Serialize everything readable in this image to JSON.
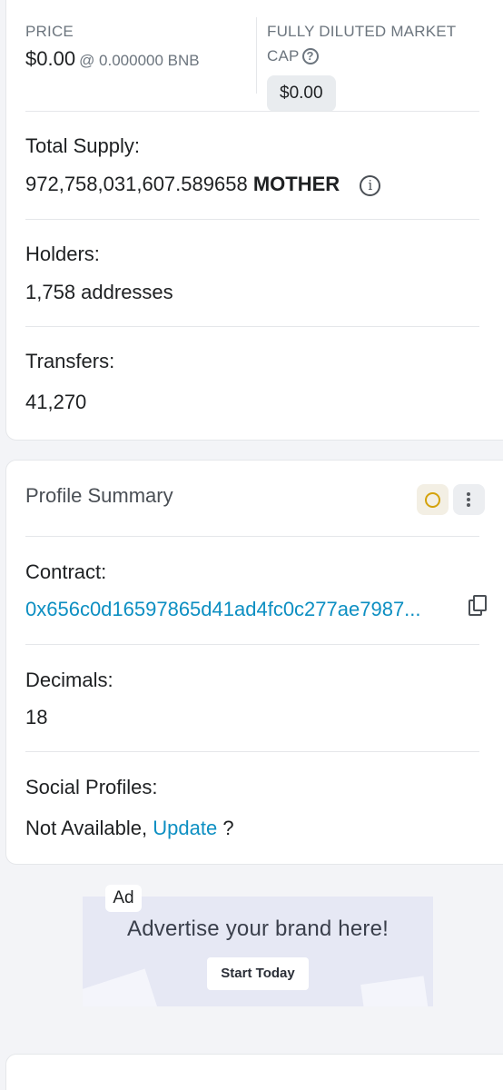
{
  "overview": {
    "price_label": "PRICE",
    "price_value": "$0.00",
    "price_bnb": "@ 0.000000 BNB",
    "mcap_label_line1": "FULLY DILUTED MARKET",
    "mcap_label_line2": "CAP",
    "mcap_help_icon": "question-circle-icon",
    "mcap_value": "$0.00",
    "total_supply_label": "Total Supply:",
    "total_supply_value": "972,758,031,607.589658",
    "token_symbol": "MOTHER",
    "info_icon": "info-circle-icon",
    "holders_label": "Holders:",
    "holders_value": "1,758 addresses",
    "transfers_label": "Transfers:",
    "transfers_value": "41,270"
  },
  "profile": {
    "title": "Profile Summary",
    "status_icon": "circle-status-icon",
    "more_icon": "vertical-dots-icon",
    "contract_label": "Contract:",
    "contract_value": "0x656c0d16597865d41ad4fc0c277ae7987...",
    "copy_icon": "copy-icon",
    "decimals_label": "Decimals:",
    "decimals_value": "18",
    "social_label": "Social Profiles:",
    "social_value": "Not Available,",
    "social_link": "Update",
    "social_suffix": "?"
  },
  "ad": {
    "tag": "Ad",
    "headline": "Advertise your brand here!",
    "cta": "Start Today"
  },
  "colors": {
    "link": "#0d8fc2",
    "status_ring": "#d4a20a",
    "background": "#f3f4f7"
  }
}
